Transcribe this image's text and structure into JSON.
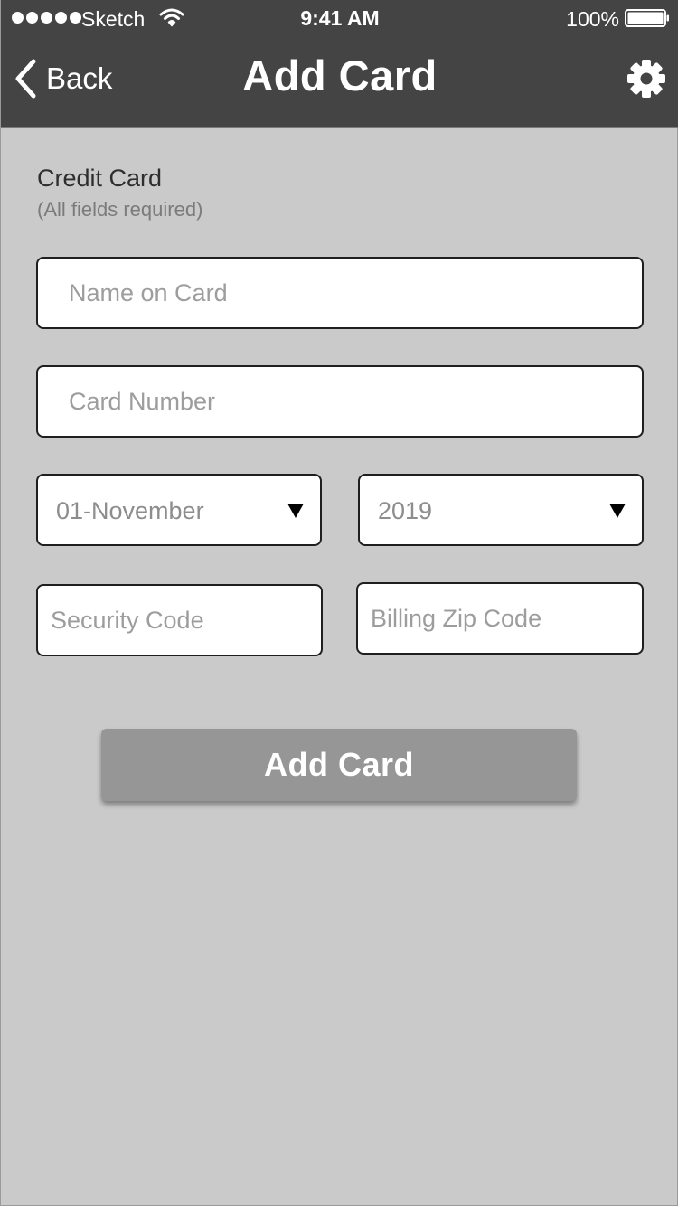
{
  "status_bar": {
    "carrier": "Sketch",
    "time": "9:41 AM",
    "battery": "100%",
    "signal_icon": "signal-dots-icon",
    "wifi_icon": "wifi-icon",
    "battery_icon": "battery-icon"
  },
  "nav": {
    "back_label": "Back",
    "title": "Add Card",
    "back_icon": "chevron-left-icon",
    "settings_icon": "gear-icon"
  },
  "form": {
    "section_title": "Credit Card",
    "section_subtitle": "(All fields required)",
    "name_placeholder": "Name on Card",
    "name_value": "",
    "card_number_placeholder": "Card Number",
    "card_number_value": "",
    "month_selected": "01-November",
    "year_selected": "2019",
    "security_code_placeholder": "Security Code",
    "security_code_value": "",
    "zip_placeholder": "Billing Zip Code",
    "zip_value": "",
    "submit_label": "Add Card"
  },
  "colors": {
    "nav_background": "#444444",
    "screen_background": "#cacaca",
    "button_background": "#969696",
    "field_border": "#1f1f1f",
    "placeholder_text": "#9d9d9d"
  }
}
